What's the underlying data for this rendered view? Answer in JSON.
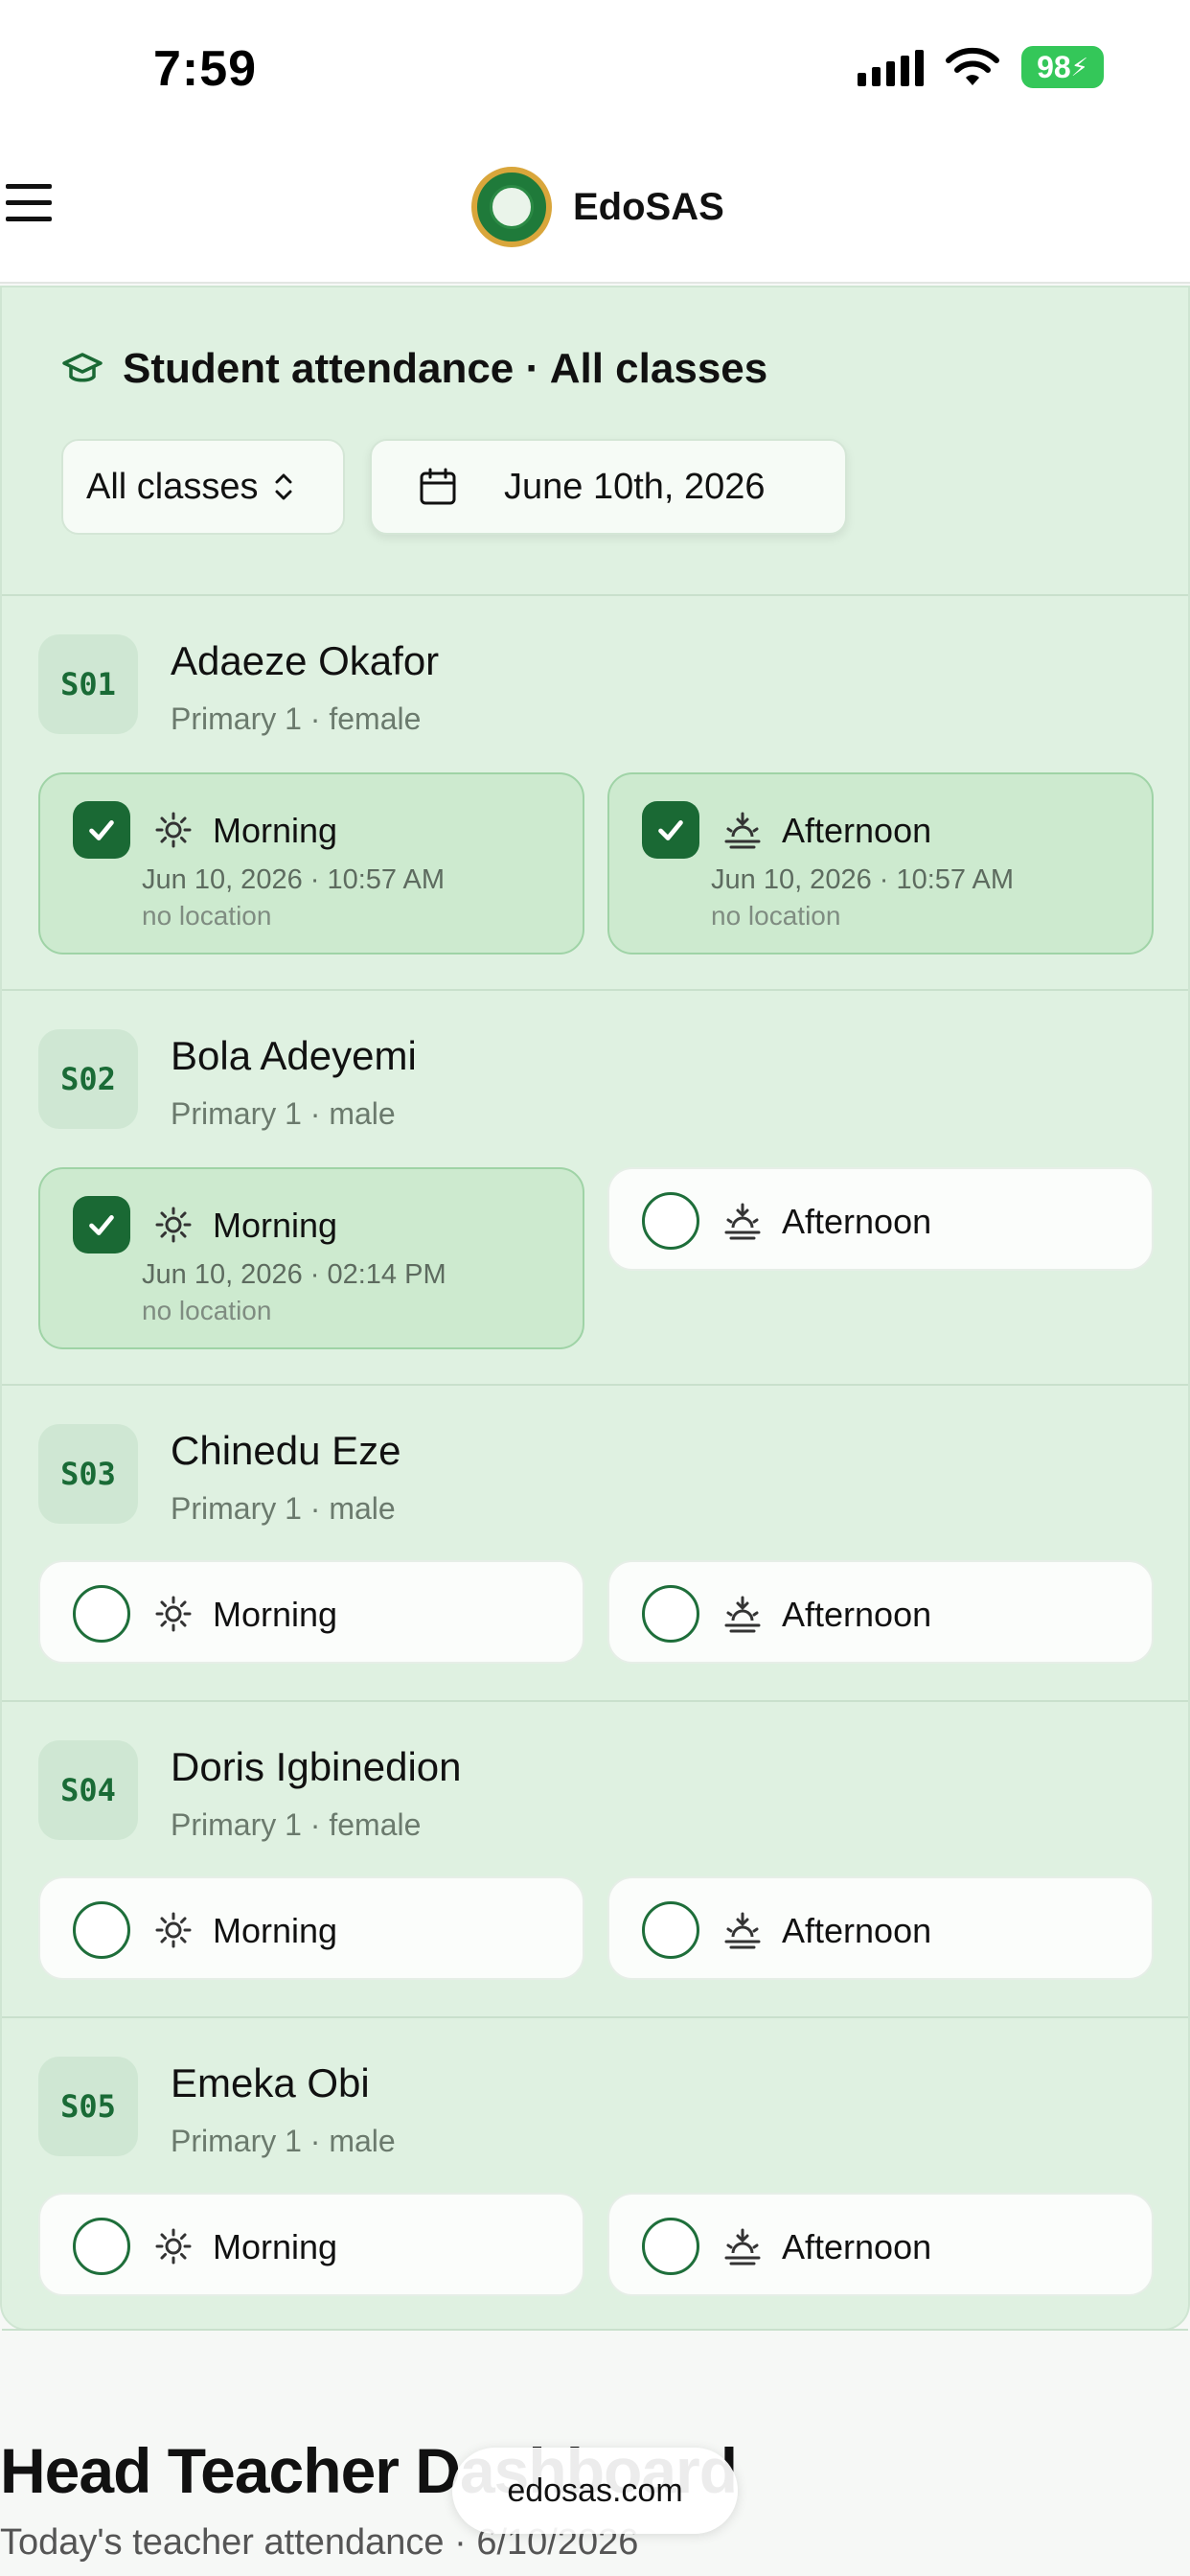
{
  "status_bar": {
    "time": "7:59",
    "battery": "98"
  },
  "header": {
    "app_name": "EdoSAS"
  },
  "attendance": {
    "title": "Student attendance · All classes",
    "class_filter": "All classes",
    "date": "June 10th, 2026",
    "students": [
      {
        "id": "S01",
        "name": "Adaeze Okafor",
        "meta": "Primary 1 · female",
        "morning": {
          "label": "Morning",
          "checked": true,
          "time": "Jun 10, 2026 · 10:57 AM",
          "location": "no location"
        },
        "afternoon": {
          "label": "Afternoon",
          "checked": true,
          "time": "Jun 10, 2026 · 10:57 AM",
          "location": "no location"
        }
      },
      {
        "id": "S02",
        "name": "Bola Adeyemi",
        "meta": "Primary 1 · male",
        "morning": {
          "label": "Morning",
          "checked": true,
          "time": "Jun 10, 2026 · 02:14 PM",
          "location": "no location"
        },
        "afternoon": {
          "label": "Afternoon",
          "checked": false
        }
      },
      {
        "id": "S03",
        "name": "Chinedu Eze",
        "meta": "Primary 1 · male",
        "morning": {
          "label": "Morning",
          "checked": false
        },
        "afternoon": {
          "label": "Afternoon",
          "checked": false
        }
      },
      {
        "id": "S04",
        "name": "Doris Igbinedion",
        "meta": "Primary 1 · female",
        "morning": {
          "label": "Morning",
          "checked": false
        },
        "afternoon": {
          "label": "Afternoon",
          "checked": false
        }
      },
      {
        "id": "S05",
        "name": "Emeka Obi",
        "meta": "Primary 1 · male",
        "morning": {
          "label": "Morning",
          "checked": false
        },
        "afternoon": {
          "label": "Afternoon",
          "checked": false
        }
      }
    ]
  },
  "dashboard": {
    "title": "Head Teacher Dashboard",
    "subtitle": "Today's teacher attendance · 6/10/2026"
  },
  "browser": {
    "url": "edosas.com"
  },
  "colors": {
    "accent": "#1a6934",
    "card_bg": "#dff1e1",
    "checked_bg": "#cdeacf"
  }
}
